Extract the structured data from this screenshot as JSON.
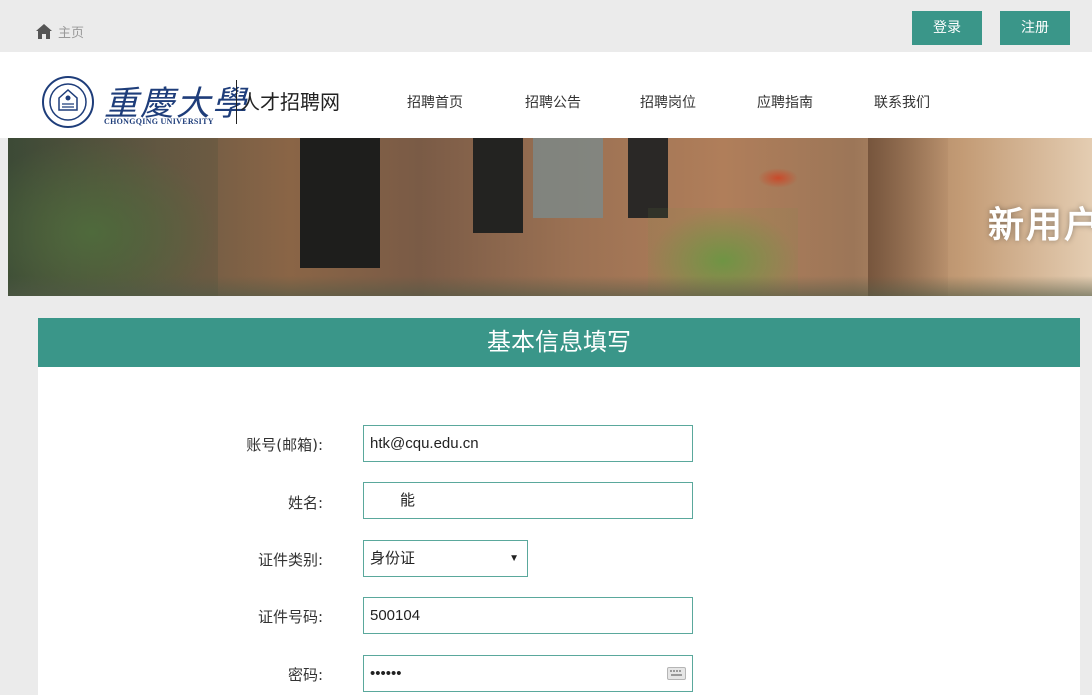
{
  "topbar": {
    "home_label": "主页",
    "login_label": "登录",
    "register_label": "注册"
  },
  "header": {
    "logo_calligraphy": "重慶大學",
    "logo_en": "CHONGQING UNIVERSITY",
    "site_title": "人才招聘网",
    "nav": [
      "招聘首页",
      "招聘公告",
      "招聘岗位",
      "应聘指南",
      "联系我们"
    ]
  },
  "banner": {
    "text": "新用户"
  },
  "form": {
    "title": "基本信息填写",
    "account_label": "账号(邮箱):",
    "account_value": "htk@cqu.edu.cn",
    "name_label": "姓名:",
    "name_value": "能",
    "id_type_label": "证件类别:",
    "id_type_value": "身份证",
    "id_number_label": "证件号码:",
    "id_number_value": "500104",
    "password_label": "密码:",
    "password_value": "••••••"
  },
  "colors": {
    "accent": "#3a9689",
    "field_border": "#5aa89c",
    "logo_blue": "#1e3d7a"
  }
}
